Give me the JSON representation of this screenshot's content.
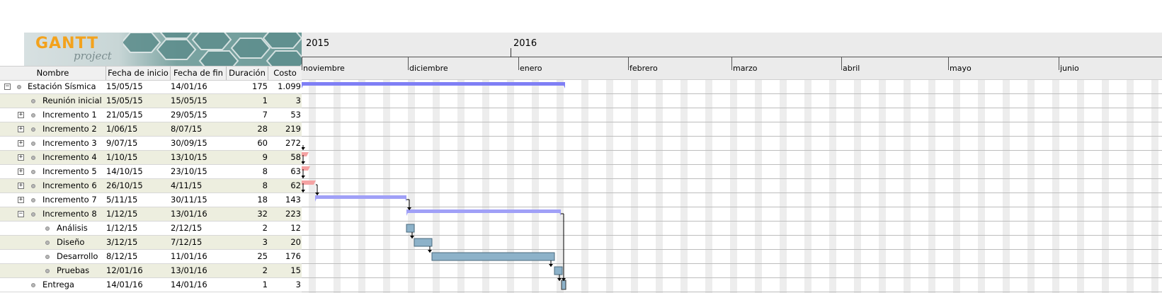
{
  "logo": {
    "text": "GANTT",
    "subtext": "project"
  },
  "table": {
    "columns": [
      "Nombre",
      "Fecha de inicio",
      "Fecha de fin",
      "Duración",
      "Costo"
    ],
    "rows": [
      {
        "name": "Estación Sísmica",
        "start": "15/05/15",
        "end": "14/01/16",
        "duration": "175",
        "cost": "1.099",
        "level": 0,
        "toggle": "-",
        "dot": true
      },
      {
        "name": "Reunión inicial",
        "start": "15/05/15",
        "end": "15/05/15",
        "duration": "1",
        "cost": "3",
        "level": 1,
        "toggle": "",
        "dot": true
      },
      {
        "name": "Incremento 1",
        "start": "21/05/15",
        "end": "29/05/15",
        "duration": "7",
        "cost": "53",
        "level": 1,
        "toggle": "+",
        "dot": true
      },
      {
        "name": "Incremento 2",
        "start": "1/06/15",
        "end": "8/07/15",
        "duration": "28",
        "cost": "219",
        "level": 1,
        "toggle": "+",
        "dot": true
      },
      {
        "name": "Incremento 3",
        "start": "9/07/15",
        "end": "30/09/15",
        "duration": "60",
        "cost": "272",
        "level": 1,
        "toggle": "+",
        "dot": true
      },
      {
        "name": "Incremento 4",
        "start": "1/10/15",
        "end": "13/10/15",
        "duration": "9",
        "cost": "58",
        "level": 1,
        "toggle": "+",
        "dot": true
      },
      {
        "name": "Incremento 5",
        "start": "14/10/15",
        "end": "23/10/15",
        "duration": "8",
        "cost": "63",
        "level": 1,
        "toggle": "+",
        "dot": true
      },
      {
        "name": "Incremento 6",
        "start": "26/10/15",
        "end": "4/11/15",
        "duration": "8",
        "cost": "62",
        "level": 1,
        "toggle": "+",
        "dot": true
      },
      {
        "name": "Incremento 7",
        "start": "5/11/15",
        "end": "30/11/15",
        "duration": "18",
        "cost": "143",
        "level": 1,
        "toggle": "+",
        "dot": true
      },
      {
        "name": "Incremento 8",
        "start": "1/12/15",
        "end": "13/01/16",
        "duration": "32",
        "cost": "223",
        "level": 1,
        "toggle": "-",
        "dot": true
      },
      {
        "name": "Análisis",
        "start": "1/12/15",
        "end": "2/12/15",
        "duration": "2",
        "cost": "12",
        "level": 2,
        "toggle": "",
        "dot": true
      },
      {
        "name": "Diseño",
        "start": "3/12/15",
        "end": "7/12/15",
        "duration": "3",
        "cost": "20",
        "level": 2,
        "toggle": "",
        "dot": true
      },
      {
        "name": "Desarrollo",
        "start": "8/12/15",
        "end": "11/01/16",
        "duration": "25",
        "cost": "176",
        "level": 2,
        "toggle": "",
        "dot": true
      },
      {
        "name": "Pruebas",
        "start": "12/01/16",
        "end": "13/01/16",
        "duration": "2",
        "cost": "15",
        "level": 2,
        "toggle": "",
        "dot": true
      },
      {
        "name": "Entrega",
        "start": "14/01/16",
        "end": "14/01/16",
        "duration": "1",
        "cost": "3",
        "level": 1,
        "toggle": "",
        "dot": true
      }
    ]
  },
  "timeline": {
    "years": [
      "2015",
      "2016"
    ],
    "months": [
      "noviembre",
      "diciembre",
      "enero",
      "febrero",
      "marzo",
      "abril",
      "mayo",
      "junio"
    ]
  },
  "colors": {
    "summary_bar": "#7f7ff5",
    "summary_bar_light": "#a0a0f7",
    "task_bar": "#8db2c9",
    "past_task": "#f5a3a3",
    "weekend_stripe": "#ededed",
    "row_shade": "#edeedf"
  }
}
